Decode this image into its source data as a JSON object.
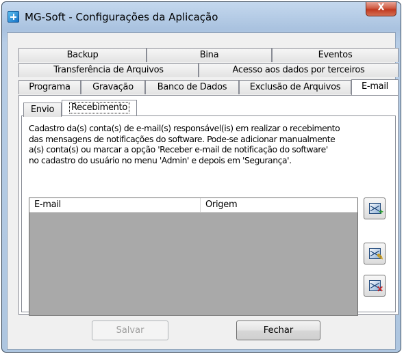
{
  "window": {
    "title": "MG-Soft - Configurações da Aplicação",
    "close_label": "X"
  },
  "main_tabs": {
    "row1": [
      "Backup",
      "Bina",
      "Eventos"
    ],
    "row2": [
      "Transferência de Arquivos",
      "Acesso aos dados por terceiros"
    ],
    "row3": [
      "Programa",
      "Gravação",
      "Banco de Dados",
      "Exclusão de Arquivos",
      "E-mail"
    ],
    "active": "E-mail"
  },
  "email_tabs": {
    "items": [
      "Envio",
      "Recebimento"
    ],
    "active": "Recebimento"
  },
  "recebimento": {
    "description": "Cadastro da(s) conta(s) de e-mail(s) responsável(is) em realizar o recebimento\ndas mensagens de notificações do software. Pode-se adicionar manualmente\na(s) conta(s) ou marcar a opção 'Receber e-mail de notificação do software'\nno cadastro do usuário no menu 'Admin' e depois em 'Segurança'.",
    "grid": {
      "columns": [
        "E-mail",
        "Origem"
      ],
      "rows": []
    },
    "side_buttons": [
      {
        "icon": "add-email-icon"
      },
      {
        "icon": "edit-email-icon"
      },
      {
        "icon": "delete-email-icon"
      }
    ]
  },
  "footer": {
    "save_label": "Salvar",
    "save_enabled": false,
    "close_label": "Fechar"
  },
  "colors": {
    "window_frame": "#aec6e0",
    "close_button": "#c0391f",
    "grid_background": "#a9a9a9"
  }
}
